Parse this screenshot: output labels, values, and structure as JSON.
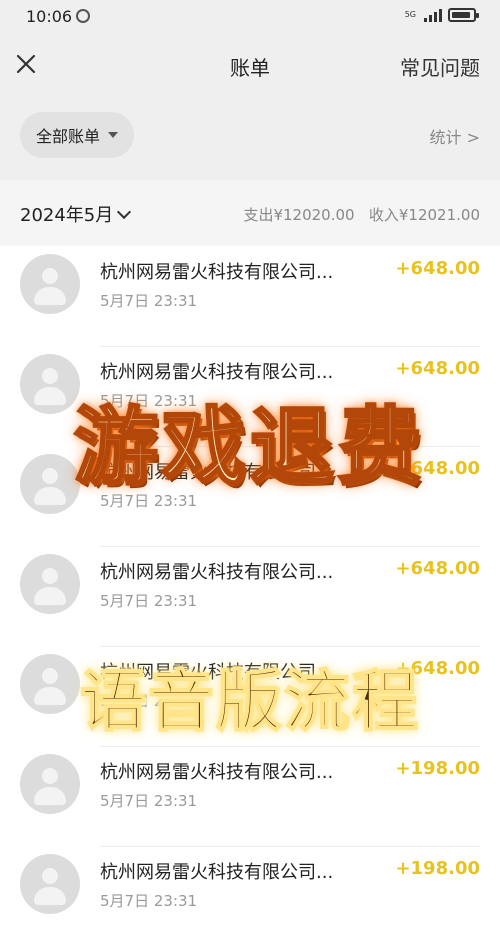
{
  "status_bar": {
    "time": "10:06",
    "network": "5G",
    "signal_icon": "signal-bars-icon",
    "battery_icon": "battery-icon",
    "notification_icon": "app-notification-icon"
  },
  "header": {
    "title": "账单",
    "faq_label": "常见问题",
    "close_icon": "close-icon"
  },
  "filter": {
    "all_bills_label": "全部账单",
    "stats_label": "统计 >"
  },
  "month_bar": {
    "month_label": "2024年5月",
    "expense_label": "支出¥12020.00",
    "income_label": "收入¥12021.00"
  },
  "transactions": [
    {
      "merchant": "杭州网易雷火科技有限公司...",
      "time": "5月7日 23:31",
      "amount": "+648.00"
    },
    {
      "merchant": "杭州网易雷火科技有限公司...",
      "time": "5月7日 23:31",
      "amount": "+648.00"
    },
    {
      "merchant": "杭州网易雷火科技有限公司...",
      "time": "5月7日 23:31",
      "amount": "+648.00"
    },
    {
      "merchant": "杭州网易雷火科技有限公司...",
      "time": "5月7日 23:31",
      "amount": "+648.00"
    },
    {
      "merchant": "杭州网易雷火科技有限公司...",
      "time": "5月7日 23:31",
      "amount": "+648.00"
    },
    {
      "merchant": "杭州网易雷火科技有限公司...",
      "time": "5月7日 23:31",
      "amount": "+198.00"
    },
    {
      "merchant": "杭州网易雷火科技有限公司...",
      "time": "5月7日 23:31",
      "amount": "+198.00"
    }
  ],
  "overlay": {
    "title_top": "游戏退费",
    "title_bottom": "语音版流程"
  },
  "colors": {
    "amount": "#e8c21e",
    "header_bg": "#efefef",
    "overlay_top_fill": "#fff6c4",
    "overlay_top_glow": "#ff7a1a",
    "overlay_bottom_fill": "#4d2c00"
  }
}
